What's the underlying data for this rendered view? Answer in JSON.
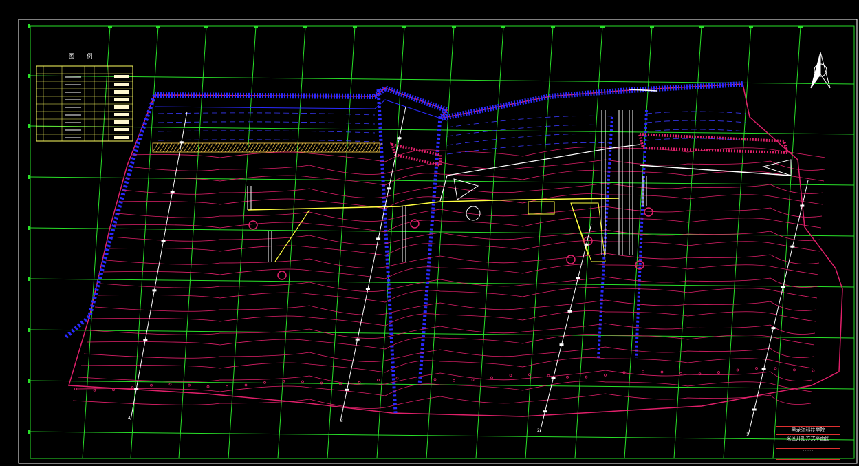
{
  "legend": {
    "title": "图 例"
  },
  "title_block": {
    "org": "黑龙江科技学院",
    "drawing_title": "采区开拓方式平面图",
    "sub_a": "· · · · ·",
    "sub_b": "· · · · ·",
    "sub_c": "· · · · ·"
  },
  "exploration_lines": [
    "4",
    "3",
    "2",
    "1"
  ],
  "colors": {
    "grid": "#29e029",
    "contour": "#e0206a",
    "boundary": "#2a2aff",
    "roadway": "#ffff40",
    "white": "#ffffff"
  }
}
